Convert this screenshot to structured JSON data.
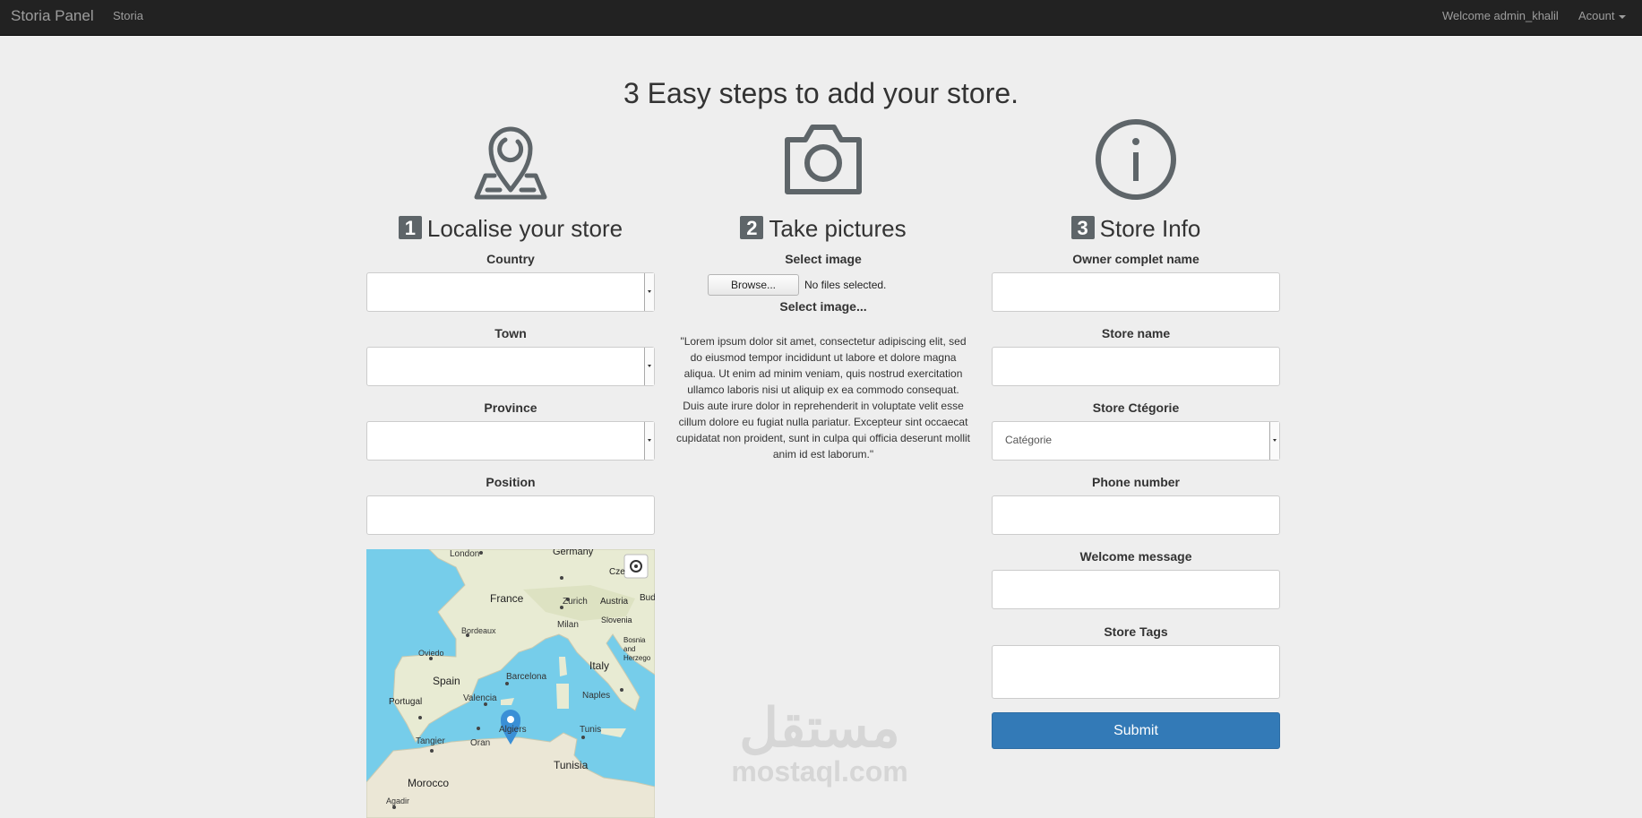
{
  "navbar": {
    "brand": "Storia Panel",
    "link": "Storia",
    "welcome": "Welcome admin_khalil",
    "account": "Acount"
  },
  "title": "3 Easy steps to add your store.",
  "steps": {
    "step1": {
      "number": "1",
      "title": "Localise your store",
      "fields": {
        "country": {
          "label": "Country"
        },
        "town": {
          "label": "Town"
        },
        "province": {
          "label": "Province"
        },
        "position": {
          "label": "Position"
        }
      },
      "map": {
        "labels": [
          "London",
          "Germany",
          "Cze",
          "France",
          "Zurich",
          "Austria",
          "Bud",
          "Milan",
          "Slovenia",
          "Bordeaux",
          "Bosnia and Herzego",
          "Oviedo",
          "Italy",
          "Spain",
          "Barcelona",
          "Portugal",
          "Valencia",
          "Naples",
          "Algiers",
          "Tunis",
          "Tangier",
          "Oran",
          "Morocco",
          "Tunisia",
          "Agadir"
        ]
      }
    },
    "step2": {
      "number": "2",
      "title": "Take pictures",
      "select_label": "Select image",
      "browse_label": "Browse...",
      "no_file": "No files selected.",
      "select_placeholder": "Select image...",
      "lorem": "\"Lorem ipsum dolor sit amet, consectetur adipiscing elit, sed do eiusmod tempor incididunt ut labore et dolore magna aliqua. Ut enim ad minim veniam, quis nostrud exercitation ullamco laboris nisi ut aliquip ex ea commodo consequat. Duis aute irure dolor in reprehenderit in voluptate velit esse cillum dolore eu fugiat nulla pariatur. Excepteur sint occaecat cupidatat non proident, sunt in culpa qui officia deserunt mollit anim id est laborum.\""
    },
    "step3": {
      "number": "3",
      "title": "Store Info",
      "fields": {
        "owner": {
          "label": "Owner complet name"
        },
        "store_name": {
          "label": "Store name"
        },
        "category": {
          "label": "Store Ctégorie",
          "value": "Catégorie"
        },
        "phone": {
          "label": "Phone number"
        },
        "welcome": {
          "label": "Welcome message"
        },
        "tags": {
          "label": "Store Tags"
        }
      },
      "submit": "Submit"
    }
  },
  "watermark": {
    "arabic": "مستقل",
    "latin": "mostaql.com"
  },
  "colors": {
    "navbar": "#222222",
    "accent": "#337ab7",
    "background": "#eeeeee",
    "icon": "#5e6569"
  }
}
